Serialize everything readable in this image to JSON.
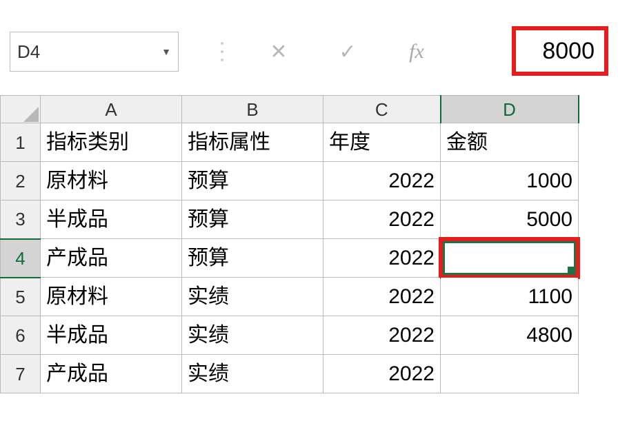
{
  "nameBox": "D4",
  "formulaBarValue": "8000",
  "selectedCell": "D4",
  "columns": [
    "A",
    "B",
    "C",
    "D"
  ],
  "headerRow": {
    "A": "指标类别",
    "B": "指标属性",
    "C": "年度",
    "D": "金额"
  },
  "rows": [
    {
      "num": "1",
      "A": "指标类别",
      "B": "指标属性",
      "C": "年度",
      "D": "金额",
      "isHeader": true
    },
    {
      "num": "2",
      "A": "原材料",
      "B": "预算",
      "C": "2022",
      "D": "1000"
    },
    {
      "num": "3",
      "A": "半成品",
      "B": "预算",
      "C": "2022",
      "D": "5000"
    },
    {
      "num": "4",
      "A": "产成品",
      "B": "预算",
      "C": "2022",
      "D": "",
      "selected": true
    },
    {
      "num": "5",
      "A": "原材料",
      "B": "实绩",
      "C": "2022",
      "D": "1100"
    },
    {
      "num": "6",
      "A": "半成品",
      "B": "实绩",
      "C": "2022",
      "D": "4800"
    },
    {
      "num": "7",
      "A": "产成品",
      "B": "实绩",
      "C": "2022",
      "D": ""
    }
  ],
  "icons": {
    "cancel": "✕",
    "enter": "✓",
    "fx": "fx"
  },
  "chart_data": {
    "type": "table",
    "columns": [
      "指标类别",
      "指标属性",
      "年度",
      "金额"
    ],
    "data": [
      [
        "原材料",
        "预算",
        2022,
        1000
      ],
      [
        "半成品",
        "预算",
        2022,
        5000
      ],
      [
        "产成品",
        "预算",
        2022,
        8000
      ],
      [
        "原材料",
        "实绩",
        2022,
        1100
      ],
      [
        "半成品",
        "实绩",
        2022,
        4800
      ],
      [
        "产成品",
        "实绩",
        2022,
        null
      ]
    ],
    "note": "D4 displayed empty in grid; formula bar shows 8000"
  }
}
